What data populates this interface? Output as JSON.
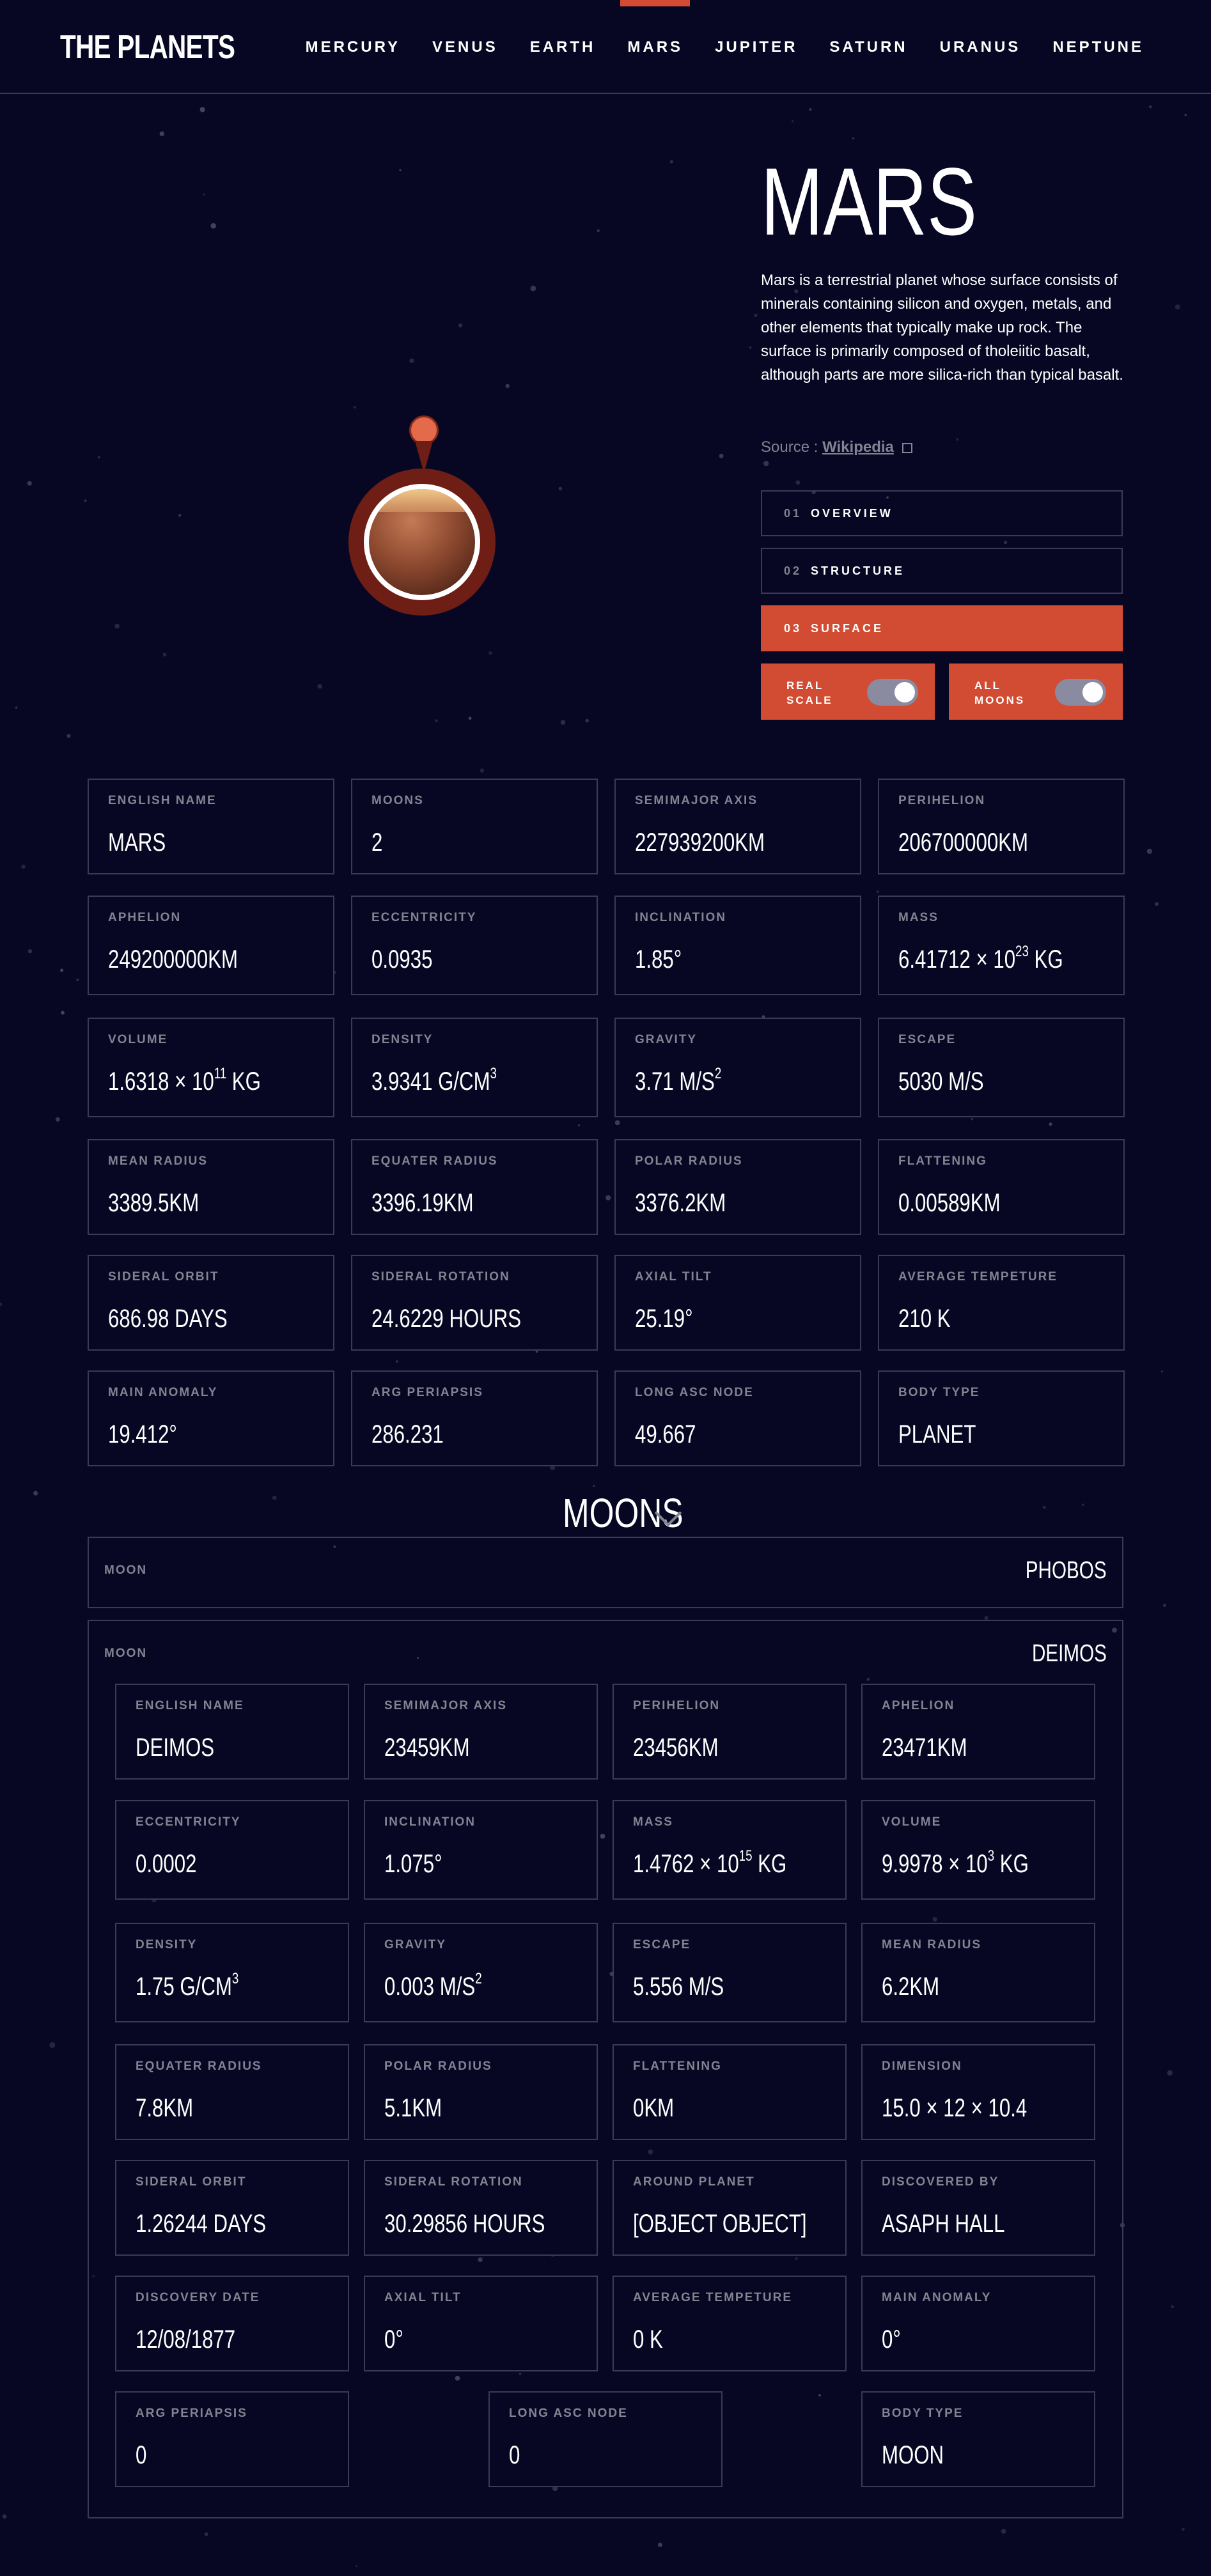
{
  "logo": "THE PLANETS",
  "nav": [
    "MERCURY",
    "VENUS",
    "EARTH",
    "MARS",
    "JUPITER",
    "SATURN",
    "URANUS",
    "NEPTUNE"
  ],
  "nav_active": "MARS",
  "planet": {
    "name": "MARS",
    "description": "Mars is a terrestrial planet whose surface consists of minerals containing silicon and oxygen, metals, and other elements that typically make up rock. The surface is primarily composed of tholeiitic basalt, although parts are more silica-rich than typical basalt.",
    "source_label": "Source :",
    "source_link": "Wikipedia"
  },
  "tabs": [
    {
      "num": "01",
      "label": "OVERVIEW"
    },
    {
      "num": "02",
      "label": "STRUCTURE"
    },
    {
      "num": "03",
      "label": "SURFACE"
    }
  ],
  "toggles": {
    "real_scale": "REAL SCALE",
    "all_moons": "ALL MOONS"
  },
  "accent_color": "#d14c32",
  "planet_stats": [
    {
      "label": "ENGLISH NAME",
      "value": "MARS"
    },
    {
      "label": "MOONS",
      "value": "2"
    },
    {
      "label": "SEMIMAJOR AXIS",
      "value": "227939200KM"
    },
    {
      "label": "PERIHELION",
      "value": "206700000KM"
    },
    {
      "label": "APHELION",
      "value": "249200000KM"
    },
    {
      "label": "ECCENTRICITY",
      "value": "0.0935"
    },
    {
      "label": "INCLINATION",
      "value": "1.85°"
    },
    {
      "label": "MASS",
      "value": "6.41712 × 10",
      "sup": "23",
      "suffix": " KG"
    },
    {
      "label": "VOLUME",
      "value": "1.6318 × 10",
      "sup": "11",
      "suffix": " KG"
    },
    {
      "label": "DENSITY",
      "value": "3.9341 G/CM",
      "sup": "3",
      "suffix": ""
    },
    {
      "label": "GRAVITY",
      "value": "3.71 M/S",
      "sup": "2",
      "suffix": ""
    },
    {
      "label": "ESCAPE",
      "value": "5030 M/S"
    },
    {
      "label": "MEAN RADIUS",
      "value": "3389.5KM"
    },
    {
      "label": "EQUATER RADIUS",
      "value": "3396.19KM"
    },
    {
      "label": "POLAR RADIUS",
      "value": "3376.2KM"
    },
    {
      "label": "FLATTENING",
      "value": "0.00589KM"
    },
    {
      "label": "SIDERAL ORBIT",
      "value": "686.98 DAYS"
    },
    {
      "label": "SIDERAL ROTATION",
      "value": "24.6229 HOURS"
    },
    {
      "label": "AXIAL TILT",
      "value": "25.19°"
    },
    {
      "label": "AVERAGE TEMPETURE",
      "value": "210 K"
    },
    {
      "label": "MAIN ANOMALY",
      "value": "19.412°"
    },
    {
      "label": "ARG PERIAPSIS",
      "value": "286.231"
    },
    {
      "label": "LONG ASC NODE",
      "value": "49.667"
    },
    {
      "label": "BODY TYPE",
      "value": "PLANET"
    }
  ],
  "moons_heading": "MOONS",
  "moons": [
    {
      "label": "MOON",
      "name": "PHOBOS"
    },
    {
      "label": "MOON",
      "name": "DEIMOS"
    }
  ],
  "moon_stats": [
    {
      "label": "ENGLISH NAME",
      "value": "DEIMOS"
    },
    {
      "label": "SEMIMAJOR AXIS",
      "value": "23459KM"
    },
    {
      "label": "PERIHELION",
      "value": "23456KM"
    },
    {
      "label": "APHELION",
      "value": "23471KM"
    },
    {
      "label": "ECCENTRICITY",
      "value": "0.0002"
    },
    {
      "label": "INCLINATION",
      "value": "1.075°"
    },
    {
      "label": "MASS",
      "value": "1.4762 × 10",
      "sup": "15",
      "suffix": " KG"
    },
    {
      "label": "VOLUME",
      "value": "9.9978 × 10",
      "sup": "3",
      "suffix": " KG"
    },
    {
      "label": "DENSITY",
      "value": "1.75 G/CM",
      "sup": "3",
      "suffix": ""
    },
    {
      "label": "GRAVITY",
      "value": "0.003 M/S",
      "sup": "2",
      "suffix": ""
    },
    {
      "label": "ESCAPE",
      "value": "5.556 M/S"
    },
    {
      "label": "MEAN RADIUS",
      "value": "6.2KM"
    },
    {
      "label": "EQUATER RADIUS",
      "value": "7.8KM"
    },
    {
      "label": "POLAR RADIUS",
      "value": "5.1KM"
    },
    {
      "label": "FLATTENING",
      "value": "0KM"
    },
    {
      "label": "DIMENSION",
      "value": "15.0 × 12 × 10.4"
    },
    {
      "label": "SIDERAL ORBIT",
      "value": "1.26244 DAYS"
    },
    {
      "label": "SIDERAL ROTATION",
      "value": "30.29856 HOURS"
    },
    {
      "label": "AROUND PLANET",
      "value": "[OBJECT OBJECT]"
    },
    {
      "label": "DISCOVERED BY",
      "value": "ASAPH HALL"
    },
    {
      "label": "DISCOVERY DATE",
      "value": "12/08/1877"
    },
    {
      "label": "AXIAL TILT",
      "value": "0°"
    },
    {
      "label": "AVERAGE TEMPETURE",
      "value": "0 K"
    },
    {
      "label": "MAIN ANOMALY",
      "value": "0°"
    },
    {
      "label": "ARG PERIAPSIS",
      "value": "0"
    },
    {
      "label": "LONG ASC NODE",
      "value": "0"
    },
    {
      "label": "BODY TYPE",
      "value": "MOON"
    }
  ]
}
